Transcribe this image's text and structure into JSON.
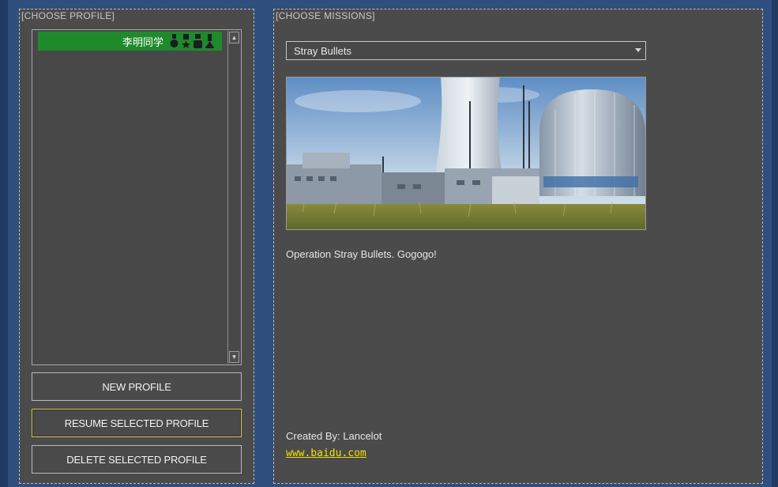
{
  "left_panel": {
    "title": "[CHOOSE PROFILE]",
    "profiles": [
      {
        "name": "李明同学",
        "selected": true,
        "medal_icons": [
          "medal-round-icon",
          "medal-star-icon",
          "medal-square-icon",
          "medal-trophy-icon"
        ]
      }
    ],
    "buttons": {
      "new_label": "NEW PROFILE",
      "resume_label": "RESUME SELECTED PROFILE",
      "delete_label": "DELETE SELECTED PROFILE"
    }
  },
  "right_panel": {
    "title": "[CHOOSE MISSIONS]",
    "mission_select": {
      "selected": "Stray Bullets"
    },
    "description": "Operation Stray Bullets. Gogogo!",
    "created_by": "Created By: Lancelot",
    "link": "www.baidu.com"
  },
  "colors": {
    "background": "#2f4f7f",
    "panel": "#4b4b4b",
    "selected_row": "#1f8a2c",
    "focus_border": "#d8c64a",
    "link": "#f2e000"
  }
}
